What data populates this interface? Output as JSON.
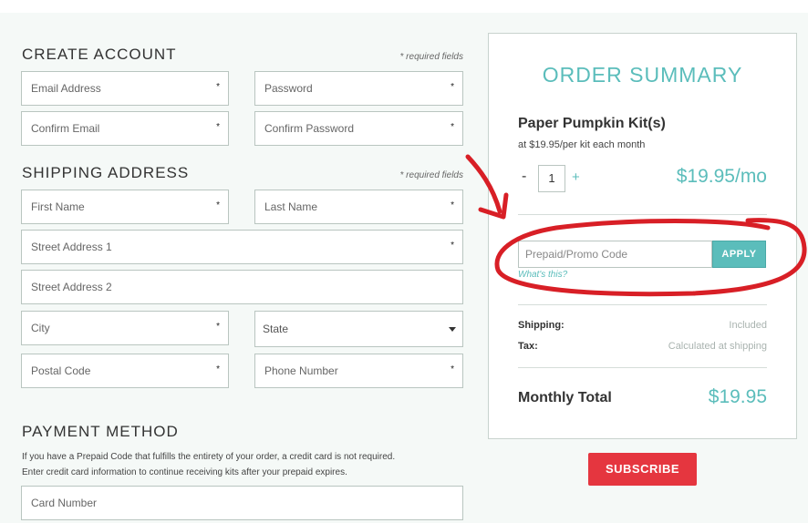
{
  "create_account": {
    "title": "CREATE ACCOUNT",
    "required_note": "* required fields",
    "email_placeholder": "Email Address",
    "password_placeholder": "Password",
    "confirm_email_placeholder": "Confirm Email",
    "confirm_password_placeholder": "Confirm Password"
  },
  "shipping": {
    "title": "SHIPPING ADDRESS",
    "required_note": "* required fields",
    "first_name_placeholder": "First Name",
    "last_name_placeholder": "Last Name",
    "street1_placeholder": "Street Address 1",
    "street2_placeholder": "Street Address 2",
    "city_placeholder": "City",
    "state_label": "State",
    "postal_placeholder": "Postal Code",
    "phone_placeholder": "Phone Number"
  },
  "payment": {
    "title": "PAYMENT METHOD",
    "note_line1": "If you have a Prepaid Code that fulfills the entirety of your order, a credit card is not required.",
    "note_line2": "Enter credit card information to continue receiving kits after your prepaid expires.",
    "card_placeholder": "Card Number"
  },
  "required_marker": "*",
  "summary": {
    "title": "ORDER SUMMARY",
    "product_name": "Paper Pumpkin Kit(s)",
    "product_sub": "at $19.95/per kit each month",
    "qty_minus": "-",
    "quantity": "1",
    "qty_plus": "+",
    "price": "$19.95/mo",
    "promo_placeholder": "Prepaid/Promo Code",
    "apply_label": "APPLY",
    "whats_this": "What's this?",
    "shipping_label": "Shipping:",
    "shipping_value": "Included",
    "tax_label": "Tax:",
    "tax_value": "Calculated at shipping",
    "total_label": "Monthly Total",
    "total_value": "$19.95"
  },
  "subscribe_label": "SUBSCRIBE",
  "colors": {
    "accent": "#5bbdbb",
    "subscribe": "#e5363f",
    "annotation": "#d81f26"
  }
}
